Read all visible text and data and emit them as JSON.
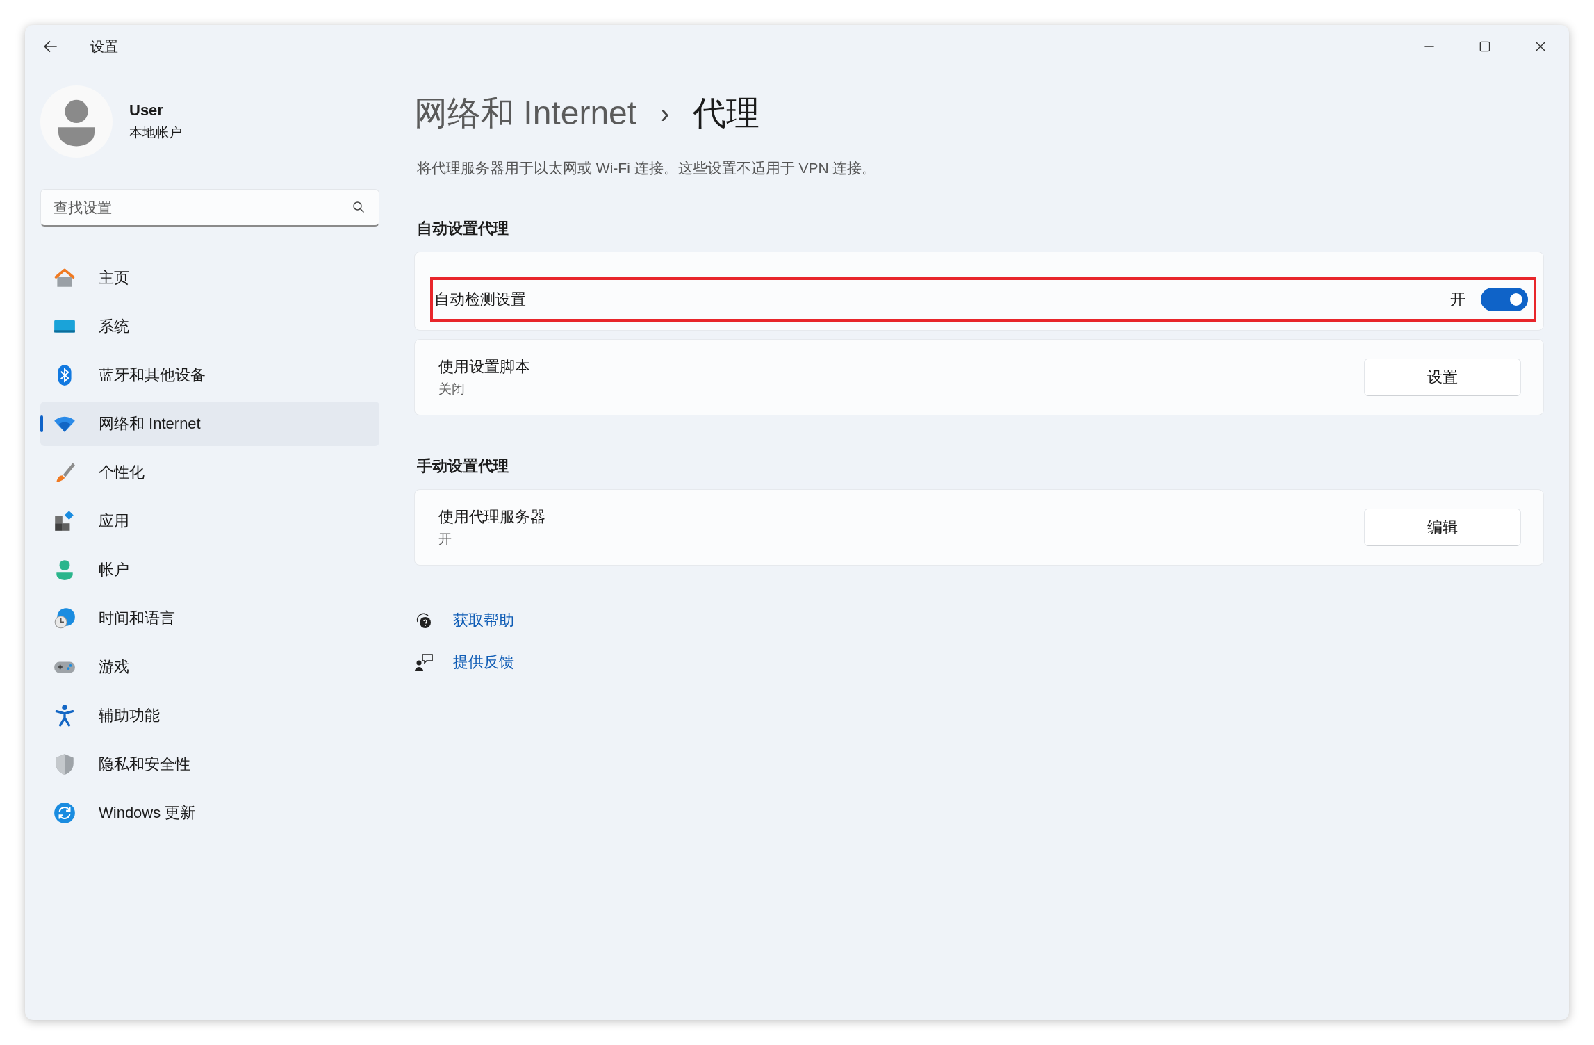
{
  "window": {
    "title": "设置"
  },
  "account": {
    "name": "User",
    "type": "本地帐户"
  },
  "search": {
    "placeholder": "查找设置"
  },
  "sidebar": {
    "items": [
      {
        "label": "主页",
        "selected": false
      },
      {
        "label": "系统",
        "selected": false
      },
      {
        "label": "蓝牙和其他设备",
        "selected": false
      },
      {
        "label": "网络和 Internet",
        "selected": true
      },
      {
        "label": "个性化",
        "selected": false
      },
      {
        "label": "应用",
        "selected": false
      },
      {
        "label": "帐户",
        "selected": false
      },
      {
        "label": "时间和语言",
        "selected": false
      },
      {
        "label": "游戏",
        "selected": false
      },
      {
        "label": "辅助功能",
        "selected": false
      },
      {
        "label": "隐私和安全性",
        "selected": false
      },
      {
        "label": "Windows 更新",
        "selected": false
      }
    ]
  },
  "breadcrumb": {
    "parent": "网络和 Internet",
    "separator": "›",
    "current": "代理"
  },
  "description": "将代理服务器用于以太网或 Wi-Fi 连接。这些设置不适用于 VPN 连接。",
  "sections": [
    {
      "title": "自动设置代理",
      "settings": [
        {
          "kind": "toggle",
          "title": "自动检测设置",
          "state_label": "开",
          "on": true,
          "highlighted": true
        },
        {
          "kind": "button",
          "title": "使用设置脚本",
          "subtitle": "关闭",
          "button": "设置",
          "highlighted": false
        }
      ]
    },
    {
      "title": "手动设置代理",
      "settings": [
        {
          "kind": "button",
          "title": "使用代理服务器",
          "subtitle": "开",
          "button": "编辑",
          "highlighted": false
        }
      ]
    }
  ],
  "links": [
    {
      "kind": "help",
      "label": "获取帮助"
    },
    {
      "kind": "feedback",
      "label": "提供反馈"
    }
  ]
}
